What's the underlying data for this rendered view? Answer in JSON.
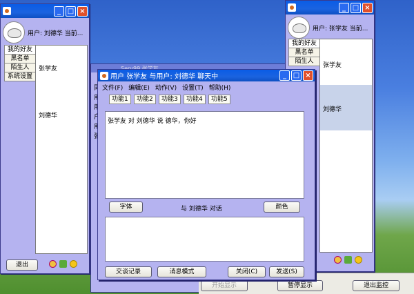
{
  "left_window": {
    "title_icon": "java-icon",
    "user_label": "用户: 刘德华 当前...",
    "tabs": [
      "我的好友",
      "黑名单",
      "陌生人",
      "系统设置"
    ],
    "friends": [
      "张学友",
      "刘德华"
    ],
    "exit_label": "退出"
  },
  "right_window": {
    "user_label": "用户: 张学友 当前...",
    "tabs": [
      "我的好友",
      "黑名单",
      "陌生人"
    ],
    "friends": [
      "张学友",
      "刘德华"
    ]
  },
  "mid_window": {
    "title": "Serv99 张学友",
    "left_letters": [
      "同",
      "用",
      "用",
      "户",
      "用",
      "张"
    ]
  },
  "chat_window": {
    "title": "用户   张学友   与用户: 刘德华  聊天中",
    "menu": [
      "文件(F)",
      "编辑(E)",
      "动作(V)",
      "设置(T)",
      "帮助(H)"
    ],
    "func_buttons": [
      "功能1",
      "功能2",
      "功能3",
      "功能4",
      "功能5"
    ],
    "message": "张学友 对 刘德华 说 德华，你好",
    "font_button": "字体",
    "talk_label": "与 刘德华 对话",
    "color_button": "颜色",
    "history_button": "交谈记录",
    "mode_button": "消息模式",
    "close_button": "关闭(C)",
    "send_button": "发送(S)"
  },
  "bottom_bar": {
    "start_show": "开始显示",
    "pause_show": "暂停显示",
    "exit_monitor": "退出监控"
  },
  "colors": {
    "frame": "#b5b3f0",
    "titlebar": "#1b63e0",
    "close": "#e0502c"
  }
}
